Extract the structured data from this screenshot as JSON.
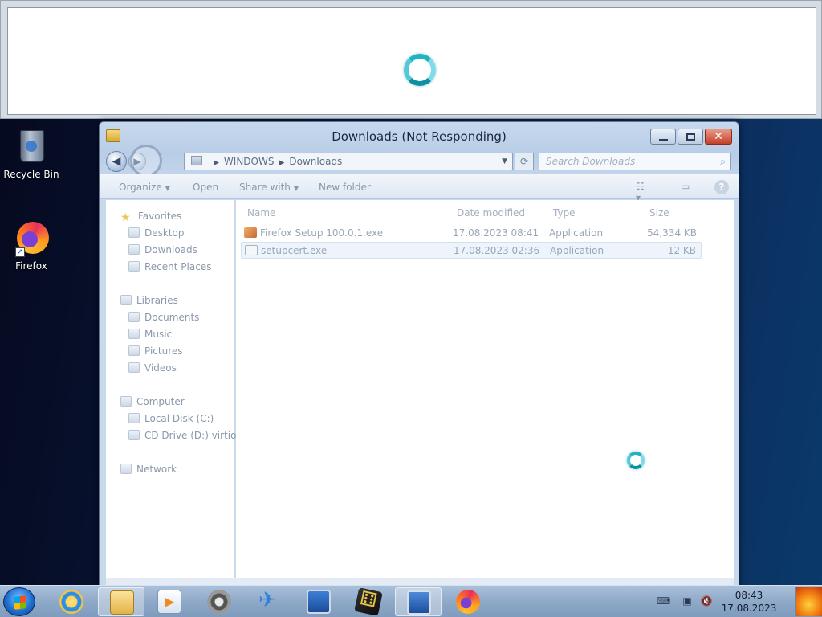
{
  "desktop": {
    "icons": [
      {
        "label": "Recycle Bin",
        "icon": "recycle-bin-icon"
      },
      {
        "label": "Firefox",
        "icon": "firefox-icon"
      }
    ]
  },
  "explorer": {
    "title": "Downloads (Not Responding)",
    "address": {
      "segments": [
        "WINDOWS",
        "Downloads"
      ]
    },
    "search_placeholder": "Search Downloads",
    "commands": {
      "organize": "Organize",
      "open": "Open",
      "share_with": "Share with",
      "new_folder": "New folder"
    },
    "nav": {
      "favorites": {
        "label": "Favorites",
        "items": [
          "Desktop",
          "Downloads",
          "Recent Places"
        ]
      },
      "libraries": {
        "label": "Libraries",
        "items": [
          "Documents",
          "Music",
          "Pictures",
          "Videos"
        ]
      },
      "computer": {
        "label": "Computer",
        "items": [
          "Local Disk (C:)",
          "CD Drive (D:) virtio-"
        ]
      },
      "network": {
        "label": "Network"
      }
    },
    "columns": {
      "name": "Name",
      "date": "Date modified",
      "type": "Type",
      "size": "Size"
    },
    "files": [
      {
        "name": "Firefox Setup 100.0.1.exe",
        "date": "17.08.2023 08:41",
        "type": "Application",
        "size": "54,334 KB"
      },
      {
        "name": "setupcert.exe",
        "date": "17.08.2023 02:36",
        "type": "Application",
        "size": "12 KB"
      }
    ]
  },
  "taskbar": {
    "clock": {
      "time": "08:43",
      "date": "17.08.2023"
    }
  },
  "colors": {
    "accent": "#1f6fd0",
    "spinner": "#1fb3c4"
  }
}
